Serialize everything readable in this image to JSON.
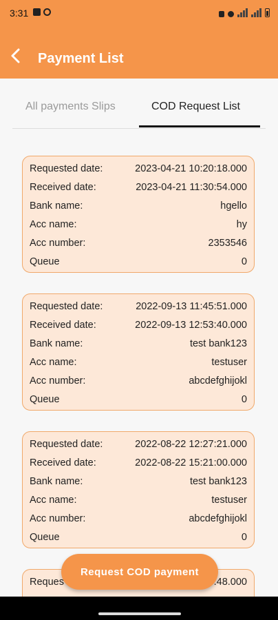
{
  "status": {
    "time": "3:31"
  },
  "header": {
    "title": "Payment List"
  },
  "tabs": [
    {
      "label": "All payments Slips"
    },
    {
      "label": "COD Request List"
    }
  ],
  "labels": {
    "requested": "Requested date:",
    "received": "Received date:",
    "bank": "Bank name:",
    "acc_name": "Acc name:",
    "acc_number": "Acc number:",
    "queue": "Queue"
  },
  "requests": [
    {
      "requested_date": "2023-04-21 10:20:18.000",
      "received_date": "2023-04-21 11:30:54.000",
      "bank_name": "hgello",
      "acc_name": "hy",
      "acc_number": "2353546",
      "queue": "0"
    },
    {
      "requested_date": "2022-09-13 11:45:51.000",
      "received_date": "2022-09-13 12:53:40.000",
      "bank_name": "test bank123",
      "acc_name": "testuser",
      "acc_number": "abcdefghijokl",
      "queue": "0"
    },
    {
      "requested_date": "2022-08-22 12:27:21.000",
      "received_date": "2022-08-22 15:21:00.000",
      "bank_name": "test bank123",
      "acc_name": "testuser",
      "acc_number": "abcdefghijokl",
      "queue": "0"
    },
    {
      "requested_label_partial": "Reques",
      "requested_date_partial": ".48.000"
    }
  ],
  "fab": {
    "label": "Request COD payment"
  },
  "colors": {
    "accent": "#f5954a",
    "card_bg": "#fde8d8",
    "card_border": "#f0a86a"
  }
}
